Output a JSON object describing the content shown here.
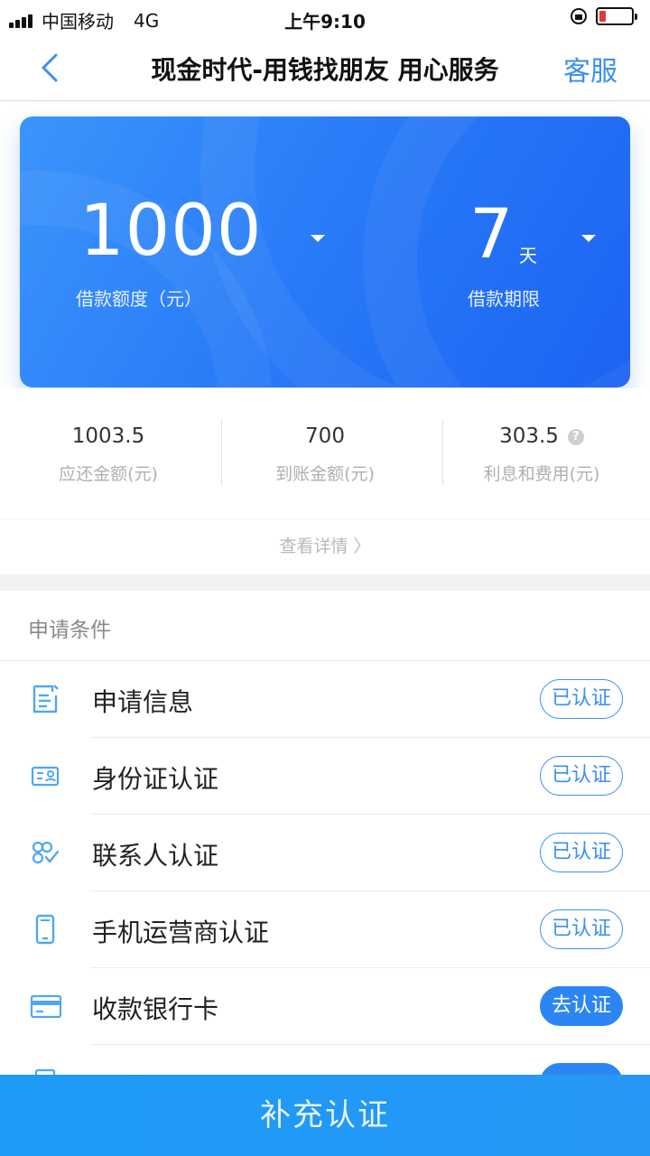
{
  "status_bar": {
    "carrier": "中国移动",
    "network": "4G",
    "time": "上午9:10",
    "battery_level": 0.2
  },
  "nav": {
    "title": "现金时代-用钱找朋友 用心服务",
    "service": "客服"
  },
  "loan": {
    "amount": "1000",
    "amount_label": "借款额度（元）",
    "term": "7",
    "term_unit": "天",
    "term_label": "借款期限"
  },
  "stats": [
    {
      "value": "1003.5",
      "label": "应还金额(元)"
    },
    {
      "value": "700",
      "label": "到账金额(元)"
    },
    {
      "value": "303.5",
      "label": "利息和费用(元)"
    }
  ],
  "details_link": "查看详情 〉",
  "conditions": {
    "title": "申请条件",
    "items": [
      {
        "label": "申请信息",
        "status": "已认证",
        "icon": "form-icon"
      },
      {
        "label": "身份证认证",
        "status": "已认证",
        "icon": "id-card-icon"
      },
      {
        "label": "联系人认证",
        "status": "已认证",
        "icon": "contacts-icon"
      },
      {
        "label": "手机运营商认证",
        "status": "已认证",
        "icon": "phone-icon"
      },
      {
        "label": "收款银行卡",
        "status": "去认证",
        "icon": "bank-card-icon"
      }
    ]
  },
  "submit_button": "补充认证",
  "colors": {
    "accent": "#3a8ef6",
    "hero_start": "#3b95fb",
    "hero_end": "#1c63f2",
    "button": "#1c9bf7"
  }
}
